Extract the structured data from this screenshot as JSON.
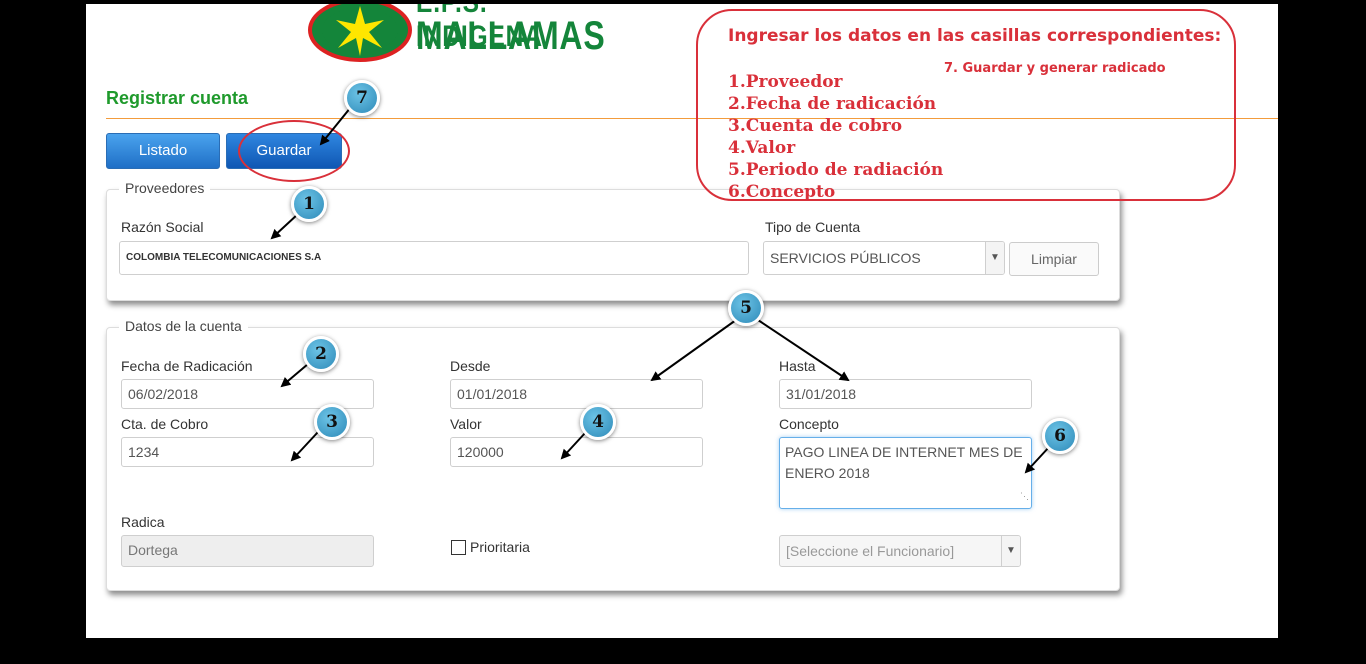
{
  "logo": {
    "line1": "E.P.S. INDIGENA",
    "line2": "MALLAMAS"
  },
  "page_title": "Registrar cuenta",
  "toolbar": {
    "listado_label": "Listado",
    "guardar_label": "Guardar"
  },
  "proveedores": {
    "legend": "Proveedores",
    "razon_social_label": "Razón Social",
    "razon_social_value": "COLOMBIA TELECOMUNICACIONES S.A",
    "tipo_cuenta_label": "Tipo de Cuenta",
    "tipo_cuenta_value": "SERVICIOS PÚBLICOS",
    "limpiar_label": "Limpiar"
  },
  "datos": {
    "legend": "Datos de la cuenta",
    "fecha_label": "Fecha de Radicación",
    "fecha_value": "06/02/2018",
    "desde_label": "Desde",
    "desde_value": "01/01/2018",
    "hasta_label": "Hasta",
    "hasta_value": "31/01/2018",
    "cta_label": "Cta. de Cobro",
    "cta_value": "1234",
    "valor_label": "Valor",
    "valor_value": "120000",
    "concepto_label": "Concepto",
    "concepto_value": "PAGO LINEA DE INTERNET MES DE ENERO 2018",
    "radica_label": "Radica",
    "radica_value": "Dortega",
    "prioritaria_label": "Prioritaria",
    "funcionario_value": "[Seleccione el Funcionario]"
  },
  "annotation": {
    "title": "Ingresar los datos en las casillas correspondientes:",
    "step7": "7.  Guardar  y generar radicado",
    "steps": [
      "1.Proveedor",
      "2.Fecha de radicación",
      "3.Cuenta de cobro",
      "4.Valor",
      "5.Periodo de radiación",
      "6.Concepto"
    ],
    "color": "#d9303a"
  },
  "badges": [
    "1",
    "2",
    "3",
    "4",
    "5",
    "6",
    "7"
  ],
  "colors": {
    "title_green": "#1f9a2c",
    "button_blue": "#1f6fc6",
    "rule_orange": "#f39c3c",
    "badge_blue": "#2e8ab8"
  }
}
